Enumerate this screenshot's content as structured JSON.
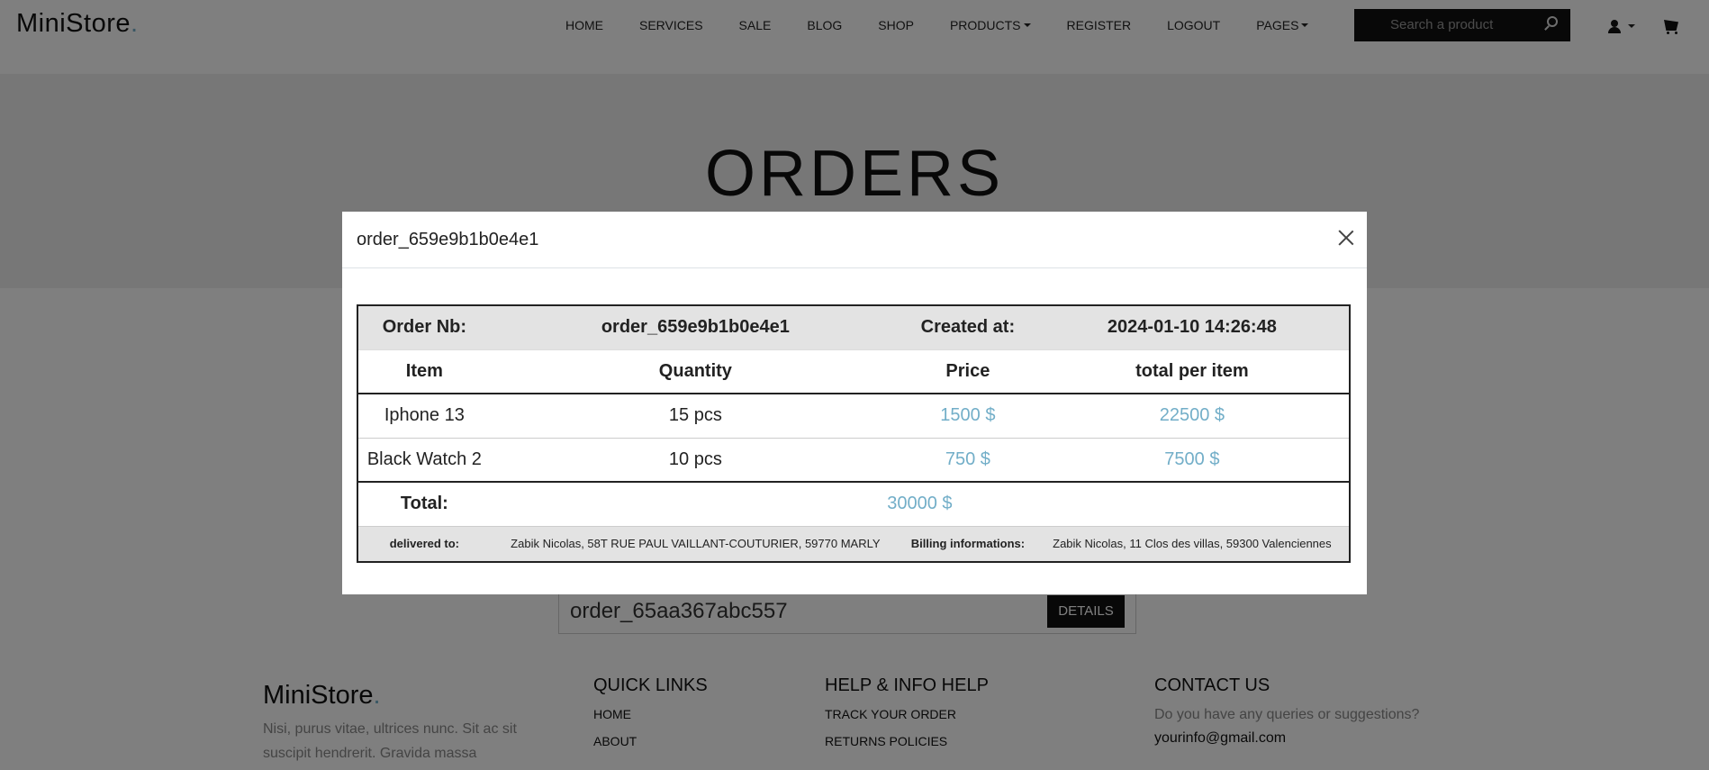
{
  "header": {
    "brand": "MiniStore",
    "brand_dot": ".",
    "nav": [
      "HOME",
      "SERVICES",
      "SALE",
      "BLOG",
      "SHOP",
      "PRODUCTS",
      "REGISTER",
      "LOGOUT",
      "PAGES"
    ],
    "search_placeholder": "Search a product"
  },
  "hero": {
    "title": "ORDERS"
  },
  "orders_list": {
    "order_id": "order_65aa367abc557",
    "details_label": "DETAILS"
  },
  "footer": {
    "brand": "MiniStore",
    "brand_dot": ".",
    "description": "Nisi, purus vitae, ultrices nunc. Sit ac sit suscipit hendrerit. Gravida massa",
    "quick_links": {
      "title": "QUICK LINKS",
      "links": [
        "HOME",
        "ABOUT"
      ]
    },
    "help": {
      "title": "HELP & INFO HELP",
      "links": [
        "TRACK YOUR ORDER",
        "RETURNS POLICIES"
      ]
    },
    "contact": {
      "title": "CONTACT US",
      "text": "Do you have any queries or suggestions?",
      "email": "yourinfo@gmail.com"
    }
  },
  "modal": {
    "title": "order_659e9b1b0e4e1",
    "meta": {
      "order_nb_label": "Order Nb:",
      "order_nb": "order_659e9b1b0e4e1",
      "created_label": "Created at:",
      "created": "2024-01-10 14:26:48"
    },
    "columns": [
      "Item",
      "Quantity",
      "Price",
      "total per item"
    ],
    "items": [
      {
        "name": "Iphone 13",
        "qty": "15 pcs",
        "price": "1500 $",
        "total": "22500 $"
      },
      {
        "name": "Black Watch 2",
        "qty": "10 pcs",
        "price": "750 $",
        "total": "7500 $"
      }
    ],
    "total_label": "Total:",
    "total_value": "30000 $",
    "delivered_label": "delivered to:",
    "delivered": "Zabik Nicolas, 58T RUE PAUL VAILLANT-COUTURIER, 59770 MARLY",
    "billing_label": "Billing informations:",
    "billing": "Zabik Nicolas, 11 Clos des villas, 59300 Valenciennes"
  },
  "colors": {
    "accent": "#72aec8",
    "overlay": "rgba(0,0,0,0.5)"
  }
}
